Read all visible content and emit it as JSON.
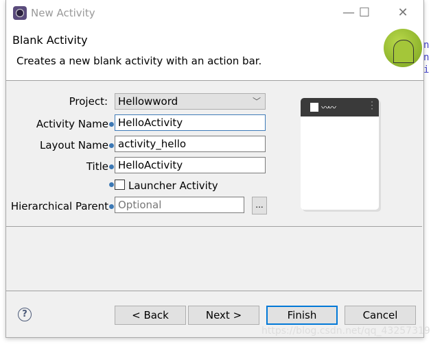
{
  "window": {
    "title": "New Activity",
    "minimize": "—",
    "maximize": "☐",
    "close": "✕"
  },
  "header": {
    "title": "Blank Activity",
    "description": "Creates a new blank activity with an action bar.",
    "icon": "android-icon"
  },
  "form": {
    "project": {
      "label": "Project:",
      "value": "Hellowword"
    },
    "activity_name": {
      "label": "Activity Name",
      "value": "HelloActivity"
    },
    "layout_name": {
      "label": "Layout Name",
      "value": "activity_hello"
    },
    "title": {
      "label": "Title",
      "value": "HelloActivity"
    },
    "launcher": {
      "label": "Launcher Activity",
      "checked": false
    },
    "parent": {
      "label": "Hierarchical Parent",
      "placeholder": "Optional",
      "browse": "..."
    }
  },
  "buttons": {
    "help": "?",
    "back": "< Back",
    "next": "Next >",
    "finish": "Finish",
    "cancel": "Cancel"
  },
  "watermark": "https://blog.csdn.net/qq_43257319",
  "background_text": [
    "n",
    "n",
    "i"
  ]
}
